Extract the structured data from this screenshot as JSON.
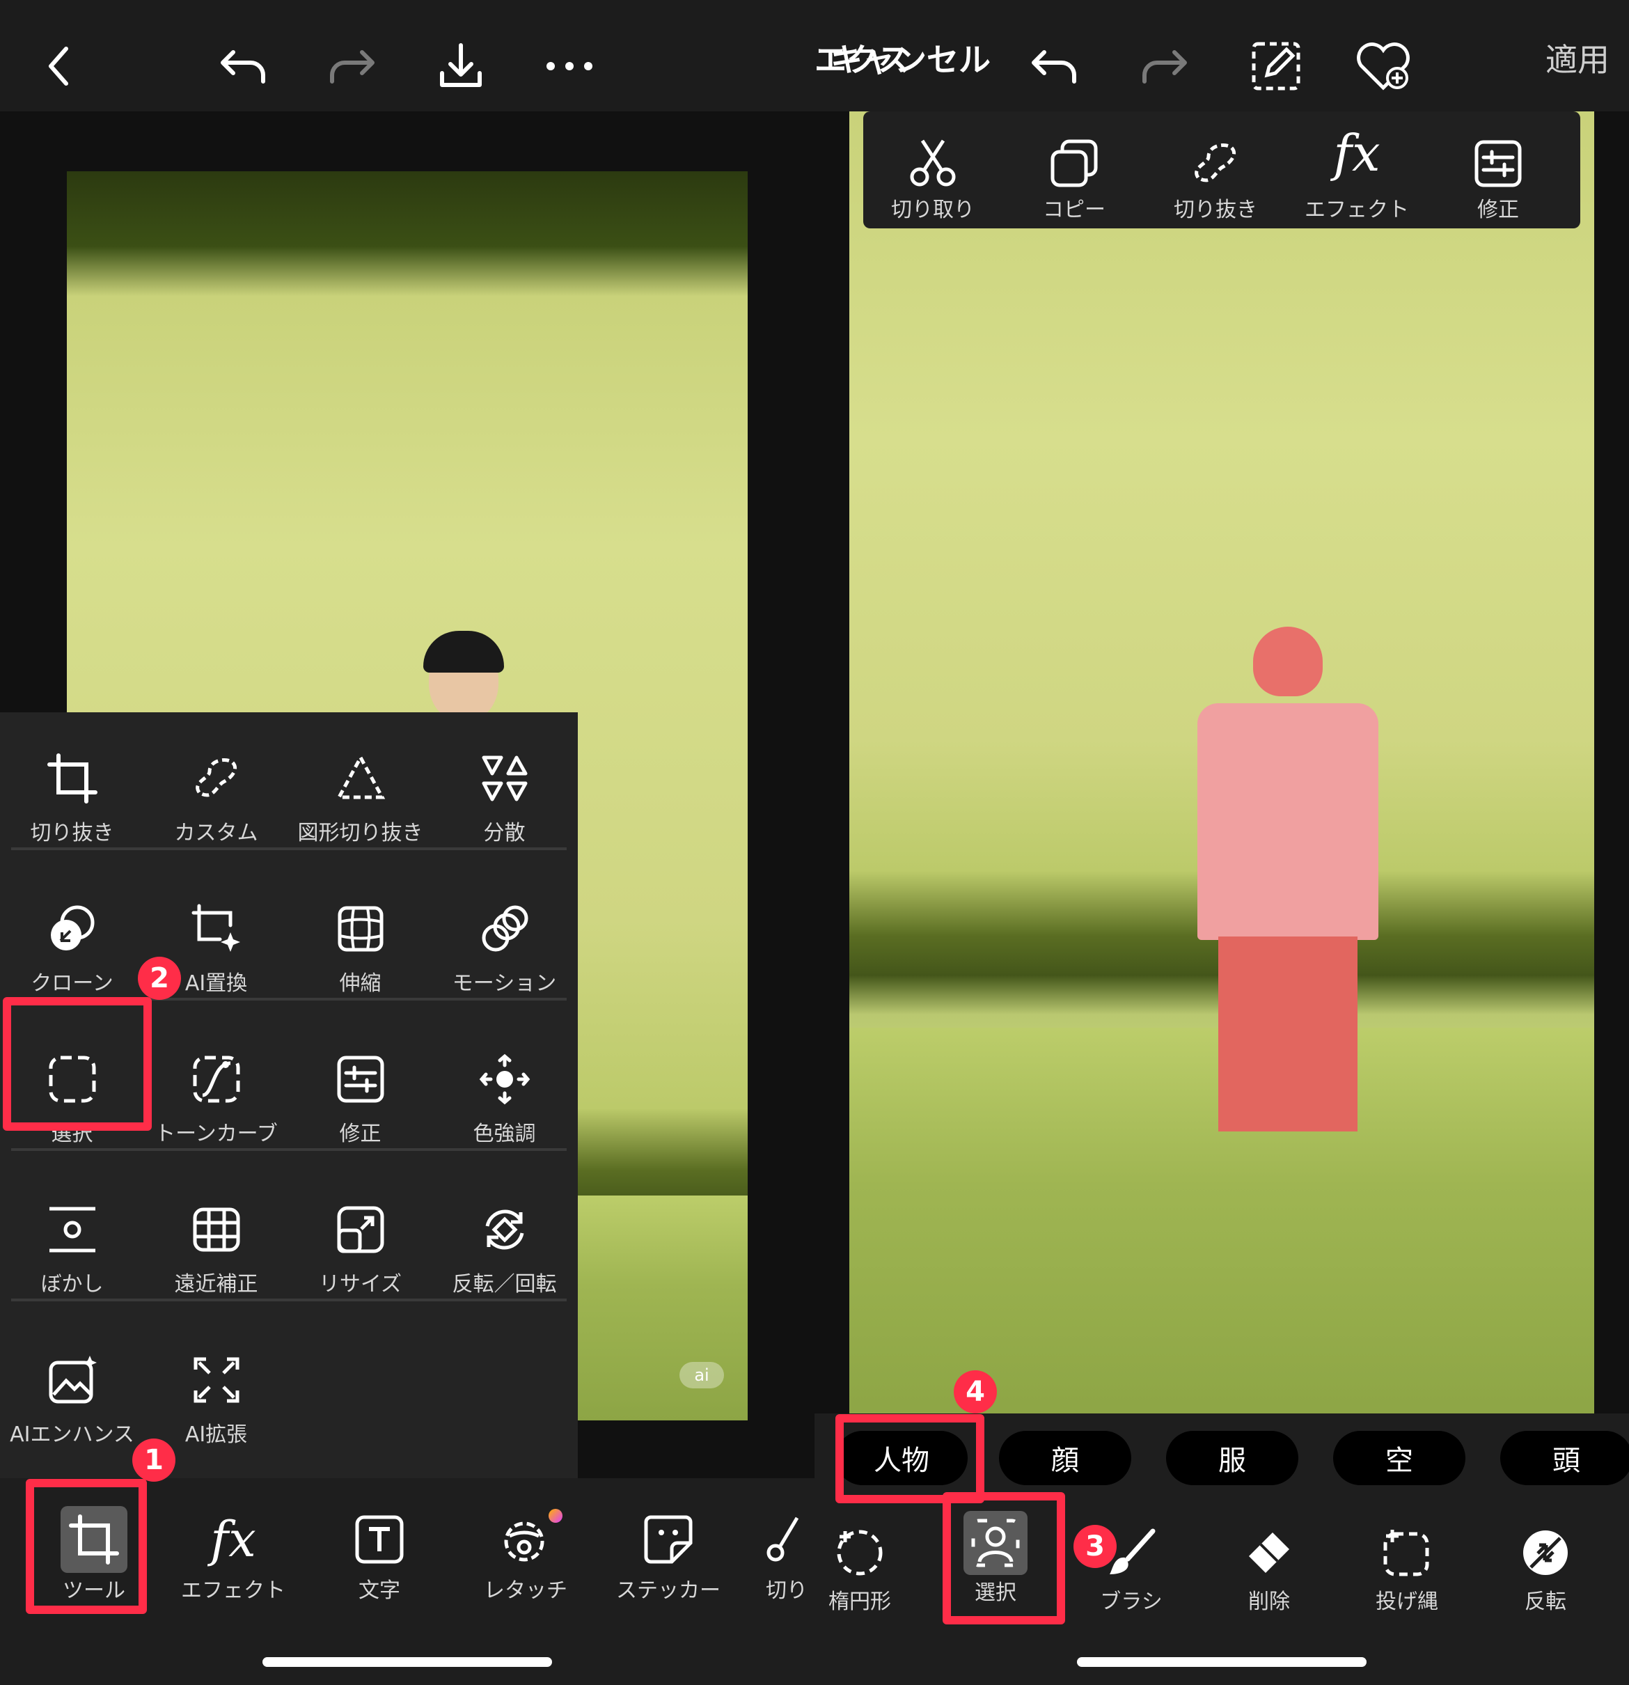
{
  "left": {
    "toolbar": {
      "back": "back-icon",
      "undo": "undo-icon",
      "redo": "redo-icon",
      "download": "download-icon",
      "more": "more-icon"
    },
    "tools": [
      {
        "label": "切り抜き",
        "icon": "crop-icon"
      },
      {
        "label": "カスタム",
        "icon": "custom-cutout-icon"
      },
      {
        "label": "図形切り抜き",
        "icon": "shape-crop-icon"
      },
      {
        "label": "分散",
        "icon": "disperse-icon"
      },
      {
        "label": "クローン",
        "icon": "clone-icon"
      },
      {
        "label": "AI置換",
        "icon": "ai-replace-icon"
      },
      {
        "label": "伸縮",
        "icon": "stretch-icon"
      },
      {
        "label": "モーション",
        "icon": "motion-icon"
      },
      {
        "label": "選択",
        "icon": "select-icon"
      },
      {
        "label": "トーンカーブ",
        "icon": "tone-curve-icon"
      },
      {
        "label": "修正",
        "icon": "adjust-icon"
      },
      {
        "label": "色強調",
        "icon": "color-splash-icon"
      },
      {
        "label": "ぼかし",
        "icon": "blur-icon"
      },
      {
        "label": "遠近補正",
        "icon": "perspective-icon"
      },
      {
        "label": "リサイズ",
        "icon": "resize-icon"
      },
      {
        "label": "反転／回転",
        "icon": "flip-rotate-icon"
      },
      {
        "label": "AIエンハンス",
        "icon": "ai-enhance-icon"
      },
      {
        "label": "AI拡張",
        "icon": "ai-expand-icon"
      }
    ],
    "bottom": [
      {
        "label": "ツール",
        "icon": "crop-icon"
      },
      {
        "label": "エフェクト",
        "icon": "fx-icon"
      },
      {
        "label": "文字",
        "icon": "text-icon"
      },
      {
        "label": "レタッチ",
        "icon": "retouch-icon"
      },
      {
        "label": "ステッカー",
        "icon": "sticker-icon"
      },
      {
        "label": "切り",
        "icon": "scissors-icon"
      }
    ],
    "photo_watermark": "ai"
  },
  "right": {
    "toolbar": {
      "title": "エクス",
      "cancel": "キャンセル",
      "apply": "適用"
    },
    "context_menu": [
      {
        "label": "切り取り",
        "icon": "scissors-icon"
      },
      {
        "label": "コピー",
        "icon": "copy-icon"
      },
      {
        "label": "切り抜き",
        "icon": "cutout-icon"
      },
      {
        "label": "エフェクト",
        "icon": "fx-icon"
      },
      {
        "label": "修正",
        "icon": "adjust-icon"
      }
    ],
    "chips": [
      "人物",
      "顔",
      "服",
      "空",
      "頭"
    ],
    "bottom": [
      {
        "label": "楕円形",
        "icon": "ellipse-select-icon"
      },
      {
        "label": "選択",
        "icon": "person-select-icon"
      },
      {
        "label": "ブラシ",
        "icon": "brush-icon"
      },
      {
        "label": "削除",
        "icon": "eraser-icon"
      },
      {
        "label": "投げ縄",
        "icon": "lasso-icon"
      },
      {
        "label": "反転",
        "icon": "invert-icon"
      }
    ]
  },
  "badges": [
    "1",
    "2",
    "3",
    "4"
  ],
  "colors": {
    "highlight": "#ff2d48",
    "panel": "#242424",
    "bar": "#1c1c1c"
  }
}
